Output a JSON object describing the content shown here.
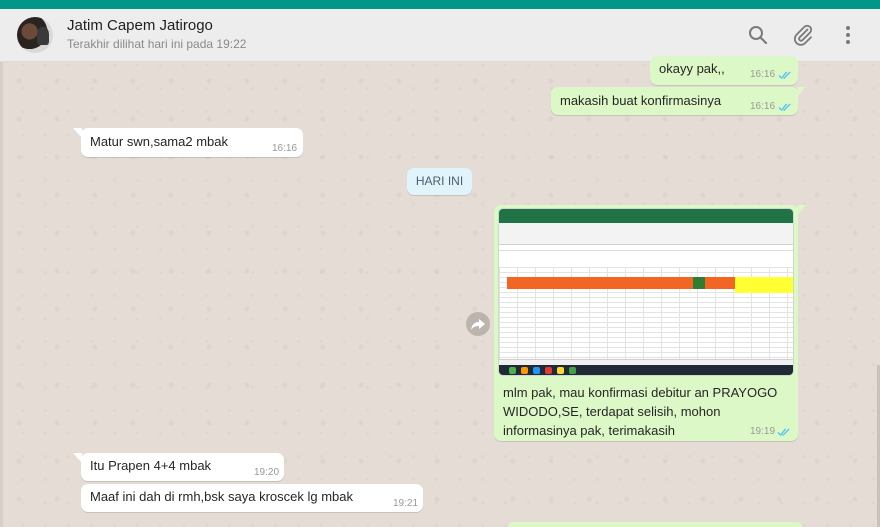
{
  "header": {
    "contact_name": "Jatim Capem Jatirogo",
    "last_seen": "Terakhir dilihat hari ini pada 19:22",
    "icons": [
      "search-icon",
      "attach-icon",
      "menu-icon"
    ]
  },
  "colors": {
    "accent": "#009688",
    "outgoing_bubble": "#dcf8c6",
    "incoming_bubble": "#ffffff",
    "read_ticks": "#4fc3f7",
    "day_chip": "#e1f3fb"
  },
  "messages": [
    {
      "dir": "out",
      "text": "okayy pak,,",
      "time": "16:16",
      "status": "read"
    },
    {
      "dir": "out",
      "text": "makasih buat konfirmasinya",
      "time": "16:16",
      "status": "read"
    },
    {
      "dir": "in",
      "text": "Matur swn,sama2 mbak",
      "time": "16:16"
    },
    {
      "dir": "out",
      "type": "image",
      "image_desc": "excel-spreadsheet-screenshot",
      "text": "mlm pak, mau konfirmasi debitur an PRAYOGO WIDODO,SE, terdapat selisih, mohon informasinya pak, terimakasih",
      "time": "19:19",
      "status": "read"
    },
    {
      "dir": "in",
      "text": "Itu Prapen 4+4 mbak",
      "time": "19:20"
    },
    {
      "dir": "in",
      "text": "Maaf ini dah di rmh,bsk saya kroscek lg mbak",
      "time": "19:21"
    }
  ],
  "day_divider": "HARI INI"
}
